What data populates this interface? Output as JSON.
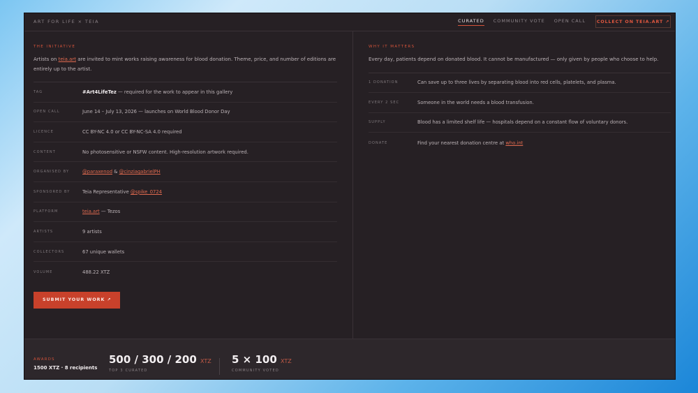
{
  "header": {
    "brand": "ART FOR LIFE × TEIA",
    "nav": [
      "CURATED",
      "COMMUNITY VOTE",
      "OPEN CALL"
    ],
    "active_nav": "CURATED",
    "collect_label": "COLLECT ON TEIA.ART",
    "collect_icon": "arrow-up-right-icon"
  },
  "initiative": {
    "title": "THE INITIATIVE",
    "text_before": "Artists on ",
    "link": "teia.art",
    "text_after": " are invited to mint works raising awareness for blood donation. Theme, price, and number of editions are entirely up to the artist."
  },
  "details": [
    {
      "key": "TAG",
      "strong": "#Art4LifeTez",
      "text": " — required for the work to appear in this gallery"
    },
    {
      "key": "OPEN CALL",
      "text": "June 14 – July 13, 2026 — launches on World Blood Donor Day"
    },
    {
      "key": "LICENCE",
      "text": "CC BY-NC 4.0 or CC BY-NC-SA 4.0 required"
    },
    {
      "key": "CONTENT",
      "text": "No photosensitive or NSFW content. High-resolution artwork required."
    },
    {
      "key": "ORGANISED BY",
      "link1": "@paraxenod",
      "mid": " & ",
      "link2": "@cinziagabrielPH"
    },
    {
      "key": "SPONSORED BY",
      "text": "Teia Representative ",
      "link1": "@spike_0724"
    },
    {
      "key": "PLATFORM",
      "link1": "teia.art",
      "text": " — Tezos"
    },
    {
      "key": "ARTISTS",
      "text": "9 artists"
    },
    {
      "key": "COLLECTORS",
      "text": "67 unique wallets"
    },
    {
      "key": "VOLUME",
      "text": "488.22 XTZ"
    }
  ],
  "submit_label": "SUBMIT YOUR WORK",
  "why": {
    "title": "WHY IT MATTERS",
    "text": "Every day, patients depend on donated blood. It cannot be manufactured — only given by people who choose to help.",
    "facts": [
      {
        "key": "1 DONATION",
        "text": "Can save up to three lives by separating blood into red cells, platelets, and plasma."
      },
      {
        "key": "EVERY 2 SEC",
        "text": "Someone in the world needs a blood transfusion."
      },
      {
        "key": "SUPPLY",
        "text": "Blood has a limited shelf life — hospitals depend on a constant flow of voluntary donors."
      },
      {
        "key": "DONATE",
        "text": "Find your nearest donation centre at ",
        "link": "who.int"
      }
    ]
  },
  "awards": {
    "label": "AWARDS",
    "total": "1500 XTZ · 8 recipients",
    "curated_value": "500 / 300 / 200",
    "curated_unit": "XTZ",
    "curated_caption": "TOP 3 CURATED",
    "community_value": "5 × 100",
    "community_unit": "XTZ",
    "community_caption": "COMMUNITY VOTED"
  },
  "colors": {
    "accent": "#d4533a",
    "background": "#262024",
    "button": "#c8412b"
  }
}
